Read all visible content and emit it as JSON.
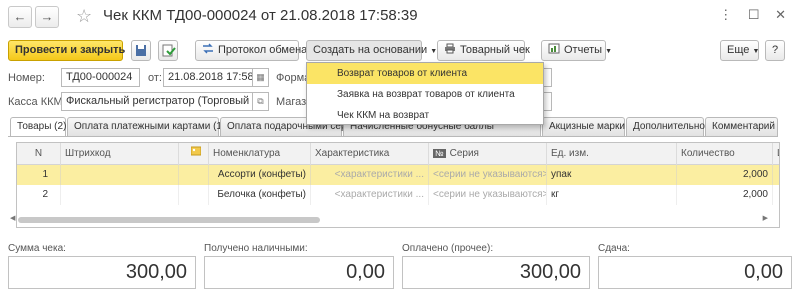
{
  "window": {
    "title": "Чек ККМ ТД00-000024 от 21.08.2018 17:58:39",
    "nav_back": "←",
    "nav_forward": "→",
    "star": "☆",
    "window_icons": "⋮ ☐ ✕"
  },
  "toolbar": {
    "post_close": "Провести и закрыть",
    "exchange_protocol": "Протокол обмена",
    "create_based_on": "Создать на основании",
    "receipt": "Товарный чек",
    "reports": "Отчеты",
    "more": "Еще",
    "help": "?"
  },
  "header": {
    "number_label": "Номер:",
    "number_value": "ТД00-000024",
    "date_label": "от:",
    "date_value": "21.08.2018 17:58:39",
    "form_label": "Форма",
    "kkm_label": "Касса ККМ:",
    "kkm_value": "Фискальный регистратор (Торговый зал)",
    "store_label": "Магаз"
  },
  "dropdown": {
    "items": [
      "Возврат товаров от клиента",
      "Заявка на возврат товаров от клиента",
      "Чек ККМ на возврат"
    ]
  },
  "tabs": [
    "Товары (2)",
    "Оплата платежными картами (1)",
    "Оплата подарочными сертификатами",
    "Начисленные бонусные баллы",
    "Акцизные марки",
    "Дополнительно",
    "Комментарий"
  ],
  "table": {
    "columns": [
      "N",
      "Штрихкод",
      "",
      "Номенклатура",
      "Характеристика",
      "Серия",
      "Ед. изм.",
      "Количество",
      "Ц"
    ],
    "series_badge": "№",
    "rows": [
      {
        "n": "1",
        "barcode": "",
        "nomenclature": "Ассорти (конфеты)",
        "characteristic": "<характеристики ...",
        "series": "<серии не указываются>",
        "unit": "упак",
        "qty": "2,000"
      },
      {
        "n": "2",
        "barcode": "",
        "nomenclature": "Белочка (конфеты)",
        "characteristic": "<характеристики ...",
        "series": "<серии не указываются>",
        "unit": "кг",
        "qty": "2,000"
      }
    ]
  },
  "totals": {
    "sum_label": "Сумма чека:",
    "sum_value": "300,00",
    "cash_label": "Получено наличными:",
    "cash_value": "0,00",
    "other_label": "Оплачено (прочее):",
    "other_value": "300,00",
    "change_label": "Сдача:",
    "change_value": "0,00"
  },
  "colors": {
    "primary_button": "#f4c81a",
    "menu_highlight": "#fbe465",
    "selected_row": "#fbeea1"
  }
}
